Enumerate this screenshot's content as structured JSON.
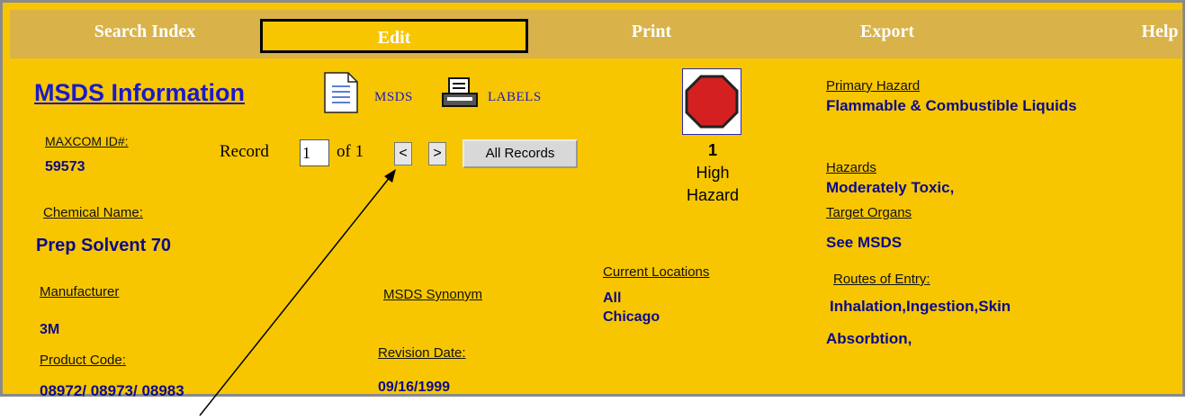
{
  "menu": {
    "search_index": "Search Index",
    "edit": "Edit",
    "print": "Print",
    "export": "Export",
    "help": "Help"
  },
  "header": {
    "title": "MSDS Information",
    "msds_link": "MSDS",
    "labels_link": "LABELS"
  },
  "record": {
    "label": "Record",
    "current": "1",
    "of": "of 1",
    "prev": "<",
    "next": ">",
    "all_records": "All Records"
  },
  "fields": {
    "maxcom_label": "MAXCOM ID#:",
    "maxcom_value": "59573",
    "chemical_label": "Chemical Name:",
    "chemical_value": "Prep Solvent 70",
    "manufacturer_label": "Manufacturer",
    "manufacturer_value": "3M",
    "product_code_label": "Product Code:",
    "product_code_value": "08972/ 08973/ 08983",
    "synonym_label": "MSDS Synonym",
    "revision_label": "Revision Date:",
    "revision_value": "09/16/1999",
    "locations_label": "Current Locations",
    "locations_values": [
      "All",
      "Chicago"
    ]
  },
  "hazard": {
    "level": "1",
    "level_text_1": "High",
    "level_text_2": "Hazard",
    "icon_color": "#d42020",
    "primary_label": "Primary Hazard",
    "primary_value": "Flammable & Combustible Liquids",
    "hazards_label": "Hazards",
    "hazards_value": "Moderately Toxic,",
    "target_label": "Target Organs",
    "target_value": "See MSDS",
    "routes_label": "Routes of Entry:",
    "routes_value_1": "Inhalation,Ingestion,Skin",
    "routes_value_2": "Absorbtion,"
  }
}
